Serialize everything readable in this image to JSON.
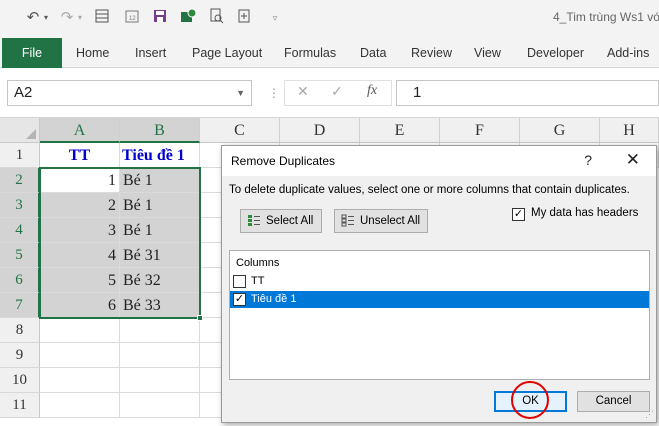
{
  "window": {
    "title": "4_Tim trùng Ws1 vớ"
  },
  "qat": {
    "undo_icon": "undo-icon",
    "redo_icon": "redo-icon",
    "icons": [
      "form-icon",
      "calendar-icon",
      "save-icon",
      "sync-icon",
      "print-preview-icon",
      "insert-icon",
      "customize-icon"
    ]
  },
  "ribbon": {
    "file_label": "File",
    "tabs": [
      "Home",
      "Insert",
      "Page Layout",
      "Formulas",
      "Data",
      "Review",
      "View",
      "Developer",
      "Add-ins"
    ]
  },
  "formula_bar": {
    "name_box": "A2",
    "fx_label": "fx",
    "value": "1"
  },
  "sheet": {
    "columns": [
      "A",
      "B",
      "C",
      "D",
      "E",
      "F",
      "G",
      "H"
    ],
    "rows": [
      "1",
      "2",
      "3",
      "4",
      "5",
      "6",
      "7",
      "8",
      "9",
      "10",
      "11"
    ],
    "header_row": [
      "TT",
      "Tiêu đề 1"
    ],
    "data": [
      [
        "1",
        "Bé 1"
      ],
      [
        "2",
        "Bé 1"
      ],
      [
        "3",
        "Bé 1"
      ],
      [
        "4",
        "Bé 31"
      ],
      [
        "5",
        "Bé 32"
      ],
      [
        "6",
        "Bé 33"
      ]
    ]
  },
  "dialog": {
    "title": "Remove Duplicates",
    "help": "?",
    "close": "✕",
    "description": "To delete duplicate values, select one or more columns that contain duplicates.",
    "select_all": "Select All",
    "unselect_all": "Unselect All",
    "my_data_has_headers": "My data has headers",
    "my_data_has_headers_checked": true,
    "columns_caption": "Columns",
    "columns": [
      {
        "label": "TT",
        "checked": false,
        "selected": false
      },
      {
        "label": "Tiêu đề 1",
        "checked": true,
        "selected": true
      }
    ],
    "ok": "OK",
    "cancel": "Cancel"
  },
  "colors": {
    "excel_green": "#217346",
    "selection_blue": "#0078d7",
    "annotation_red": "#e00000",
    "header_text_blue": "#0000cc"
  }
}
